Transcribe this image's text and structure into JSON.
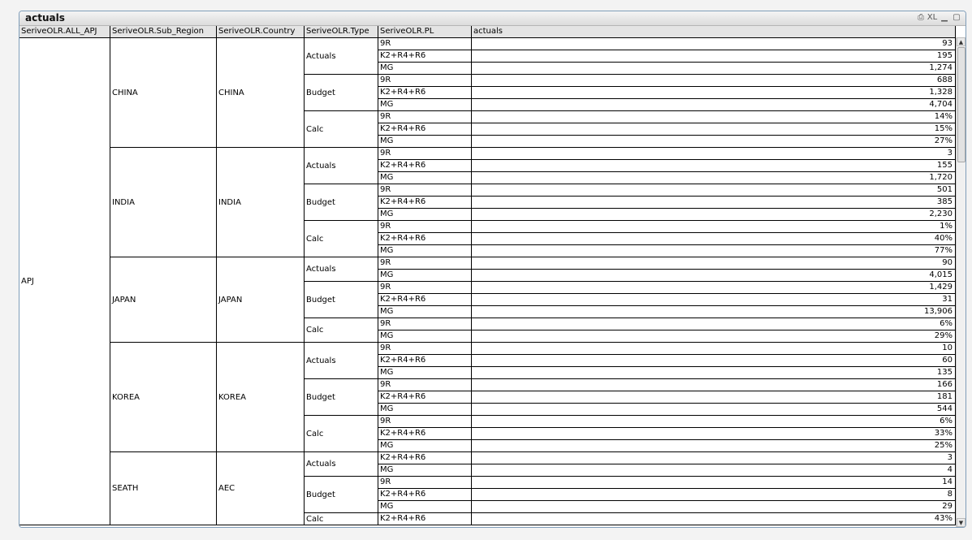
{
  "window": {
    "title": "actuals",
    "ctrl_print": "⎙",
    "ctrl_xl": "XL",
    "ctrl_min": "▁",
    "ctrl_max": "▢"
  },
  "columns": [
    "SeriveOLR.ALL_APJ",
    "SeriveOLR.Sub_Region",
    "SeriveOLR.Country",
    "SeriveOLR.Type",
    "SeriveOLR.PL",
    "actuals"
  ],
  "all_apj": "APJ",
  "regions": [
    {
      "sub_region": "CHINA",
      "country": "CHINA",
      "types": [
        {
          "type": "Actuals",
          "rows": [
            [
              "9R",
              "93"
            ],
            [
              "K2+R4+R6",
              "195"
            ],
            [
              "MG",
              "1,274"
            ]
          ]
        },
        {
          "type": "Budget",
          "rows": [
            [
              "9R",
              "688"
            ],
            [
              "K2+R4+R6",
              "1,328"
            ],
            [
              "MG",
              "4,704"
            ]
          ]
        },
        {
          "type": "Calc",
          "rows": [
            [
              "9R",
              "14%"
            ],
            [
              "K2+R4+R6",
              "15%"
            ],
            [
              "MG",
              "27%"
            ]
          ]
        }
      ]
    },
    {
      "sub_region": "INDIA",
      "country": "INDIA",
      "types": [
        {
          "type": "Actuals",
          "rows": [
            [
              "9R",
              "3"
            ],
            [
              "K2+R4+R6",
              "155"
            ],
            [
              "MG",
              "1,720"
            ]
          ]
        },
        {
          "type": "Budget",
          "rows": [
            [
              "9R",
              "501"
            ],
            [
              "K2+R4+R6",
              "385"
            ],
            [
              "MG",
              "2,230"
            ]
          ]
        },
        {
          "type": "Calc",
          "rows": [
            [
              "9R",
              "1%"
            ],
            [
              "K2+R4+R6",
              "40%"
            ],
            [
              "MG",
              "77%"
            ]
          ]
        }
      ]
    },
    {
      "sub_region": "JAPAN",
      "country": "JAPAN",
      "types": [
        {
          "type": "Actuals",
          "rows": [
            [
              "9R",
              "90"
            ],
            [
              "MG",
              "4,015"
            ]
          ]
        },
        {
          "type": "Budget",
          "rows": [
            [
              "9R",
              "1,429"
            ],
            [
              "K2+R4+R6",
              "31"
            ],
            [
              "MG",
              "13,906"
            ]
          ]
        },
        {
          "type": "Calc",
          "rows": [
            [
              "9R",
              "6%"
            ],
            [
              "MG",
              "29%"
            ]
          ]
        }
      ]
    },
    {
      "sub_region": "KOREA",
      "country": "KOREA",
      "types": [
        {
          "type": "Actuals",
          "rows": [
            [
              "9R",
              "10"
            ],
            [
              "K2+R4+R6",
              "60"
            ],
            [
              "MG",
              "135"
            ]
          ]
        },
        {
          "type": "Budget",
          "rows": [
            [
              "9R",
              "166"
            ],
            [
              "K2+R4+R6",
              "181"
            ],
            [
              "MG",
              "544"
            ]
          ]
        },
        {
          "type": "Calc",
          "rows": [
            [
              "9R",
              "6%"
            ],
            [
              "K2+R4+R6",
              "33%"
            ],
            [
              "MG",
              "25%"
            ]
          ]
        }
      ]
    },
    {
      "sub_region": "SEATH",
      "country": "AEC",
      "types": [
        {
          "type": "Actuals",
          "rows": [
            [
              "K2+R4+R6",
              "3"
            ],
            [
              "MG",
              "4"
            ]
          ]
        },
        {
          "type": "Budget",
          "rows": [
            [
              "9R",
              "14"
            ],
            [
              "K2+R4+R6",
              "8"
            ],
            [
              "MG",
              "29"
            ]
          ]
        },
        {
          "type": "Calc",
          "rows": [
            [
              "K2+R4+R6",
              "43%"
            ]
          ]
        }
      ]
    }
  ]
}
